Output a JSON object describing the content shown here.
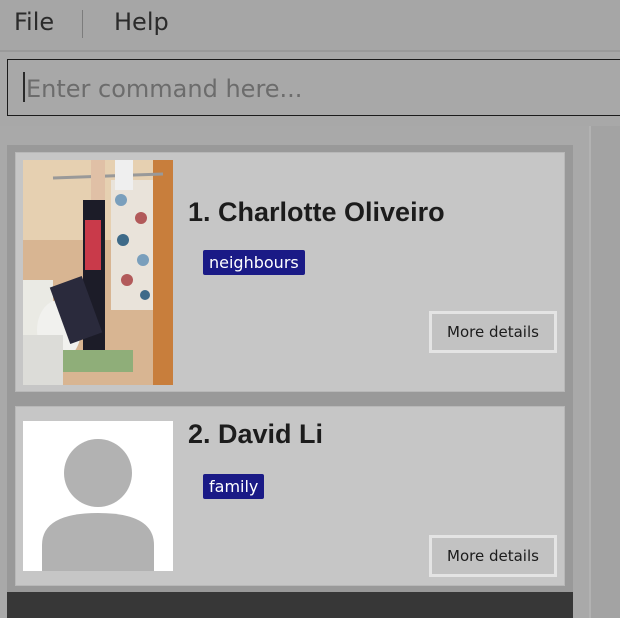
{
  "menu": {
    "file_label": "File",
    "help_label": "Help"
  },
  "command": {
    "placeholder": "Enter command here...",
    "value": ""
  },
  "persons": [
    {
      "index": "1.",
      "name": "Charlotte Oliveiro",
      "display": "1. Charlotte Oliveiro",
      "tags": [
        "neighbours"
      ],
      "button_label": "More details",
      "photo": "photo"
    },
    {
      "index": "2.",
      "name": "David Li",
      "display": "2. David Li",
      "tags": [
        "family"
      ],
      "button_label": "More details",
      "photo": "default-avatar"
    }
  ],
  "colors": {
    "tag_bg": "#1a1a86",
    "card_bg": "#c6c6c6"
  }
}
